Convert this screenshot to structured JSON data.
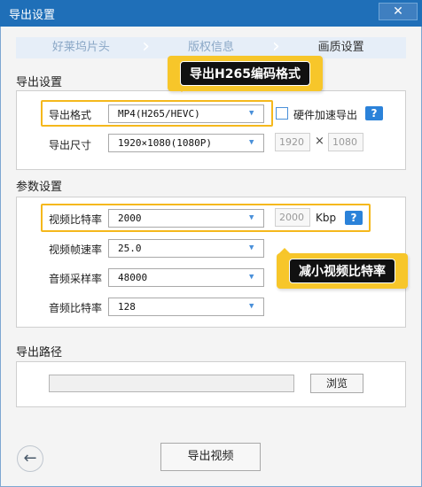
{
  "window": {
    "title": "导出设置",
    "close_icon": "close-icon"
  },
  "steps": [
    {
      "label": "好莱坞片头",
      "active": false
    },
    {
      "label": "版权信息",
      "active": false
    },
    {
      "label": "画质设置",
      "active": true
    }
  ],
  "export_settings": {
    "section_title": "导出设置",
    "format_label": "导出格式",
    "format_value": "MP4(H265/HEVC)",
    "hw_accel_label": "硬件加速导出",
    "size_label": "导出尺寸",
    "size_value": "1920×1080(1080P)",
    "custom_width": "1920",
    "custom_height": "1080",
    "times": "×"
  },
  "param_settings": {
    "section_title": "参数设置",
    "video_bitrate_label": "视频比特率",
    "video_bitrate_value": "2000",
    "bitrate_input": "2000",
    "bitrate_unit": "Kbp",
    "video_fps_label": "视频帧速率",
    "video_fps_value": "25.0",
    "audio_rate_label": "音频采样率",
    "audio_rate_value": "48000",
    "audio_bitrate_label": "音频比特率",
    "audio_bitrate_value": "128"
  },
  "export_path": {
    "section_title": "导出路径",
    "path_value": "",
    "browse_label": "浏览"
  },
  "callouts": {
    "h265": "导出H265编码格式",
    "bitrate": "减小视频比特率"
  },
  "footer": {
    "back_icon": "back-arrow-icon",
    "export_label": "导出视频"
  },
  "colors": {
    "titlebar": "#1f6fb8",
    "highlight": "#f5b81c",
    "help_icon": "#2b82d9"
  }
}
